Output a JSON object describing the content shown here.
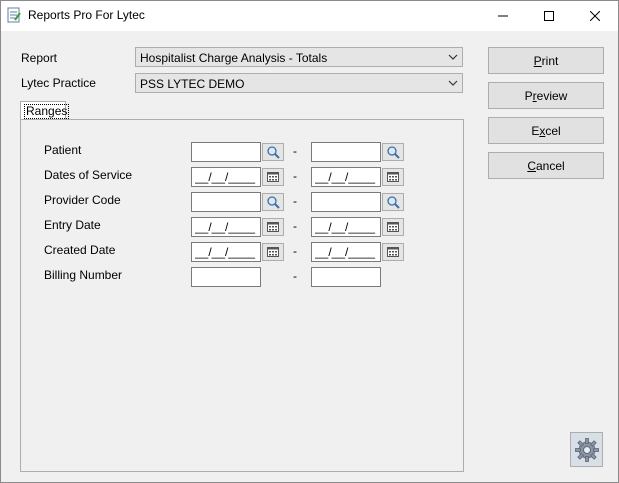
{
  "window": {
    "title": "Reports Pro For Lytec",
    "controls": {
      "minimize": "minimize-icon",
      "maximize": "maximize-icon",
      "close": "close-icon"
    }
  },
  "form": {
    "report_label": "Report",
    "report_value": "Hospitalist Charge Analysis - Totals",
    "practice_label": "Lytec Practice",
    "practice_value": "PSS LYTEC DEMO"
  },
  "tabs": [
    {
      "label": "Ranges"
    }
  ],
  "ranges": {
    "dash": "-",
    "date_mask": "__/__/____",
    "rows": [
      {
        "label": "Patient",
        "from": "",
        "to": "",
        "kind": "lookup"
      },
      {
        "label": "Dates of Service",
        "from": "__/__/____",
        "to": "__/__/____",
        "kind": "date"
      },
      {
        "label": "Provider Code",
        "from": "",
        "to": "",
        "kind": "lookup"
      },
      {
        "label": "Entry Date",
        "from": "__/__/____",
        "to": "__/__/____",
        "kind": "date"
      },
      {
        "label": "Created Date",
        "from": "__/__/____",
        "to": "__/__/____",
        "kind": "date"
      },
      {
        "label": "Billing Number",
        "from": "",
        "to": "",
        "kind": "text"
      }
    ]
  },
  "buttons": {
    "print": {
      "pre": "",
      "key": "P",
      "post": "rint"
    },
    "preview": {
      "pre": "P",
      "key": "r",
      "post": "eview"
    },
    "excel": {
      "pre": "E",
      "key": "x",
      "post": "cel"
    },
    "cancel": {
      "pre": "",
      "key": "C",
      "post": "ancel"
    }
  },
  "icons": {
    "lookup": "magnifier-icon",
    "date": "calendar-icon",
    "settings": "gear-icon",
    "app": "report-app-icon"
  }
}
